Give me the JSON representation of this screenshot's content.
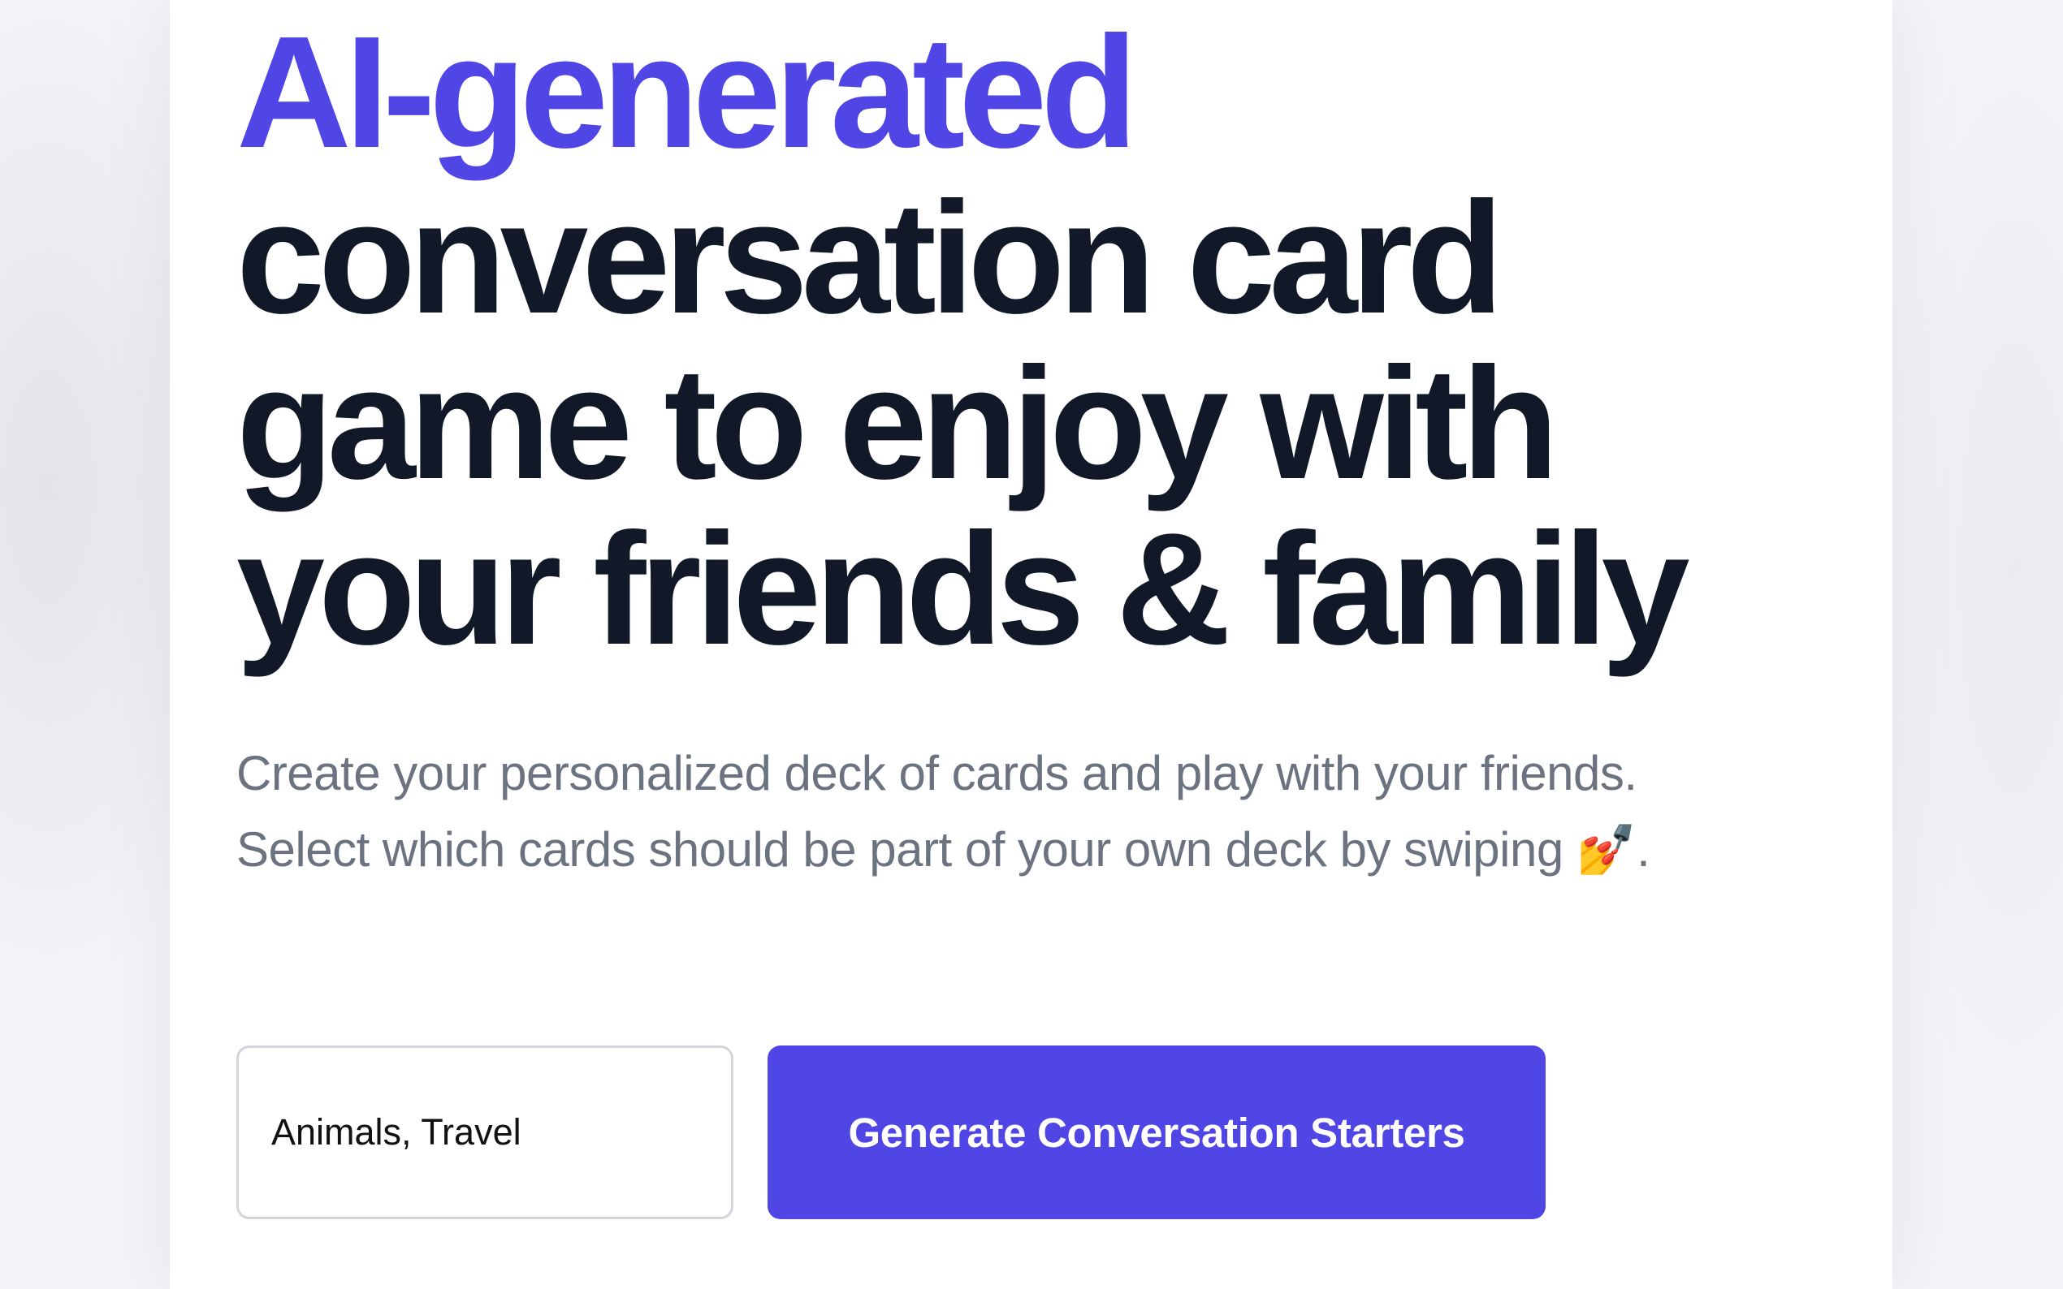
{
  "hero": {
    "headline_accent": "AI-generated",
    "headline_lines": [
      "conversation card",
      "game to enjoy with",
      "your friends & family"
    ],
    "subtitle_lines": [
      "Create your personalized deck of cards and play with your friends.",
      "Select which cards should be part of your own deck by swiping"
    ],
    "subtitle_emoji": "💅",
    "subtitle_end": "."
  },
  "form": {
    "topics_value": "Animals, Travel",
    "generate_label": "Generate Conversation Starters"
  },
  "colors": {
    "accent": "#4f46e5",
    "heading": "#111827",
    "subtitle": "#6b7280"
  }
}
